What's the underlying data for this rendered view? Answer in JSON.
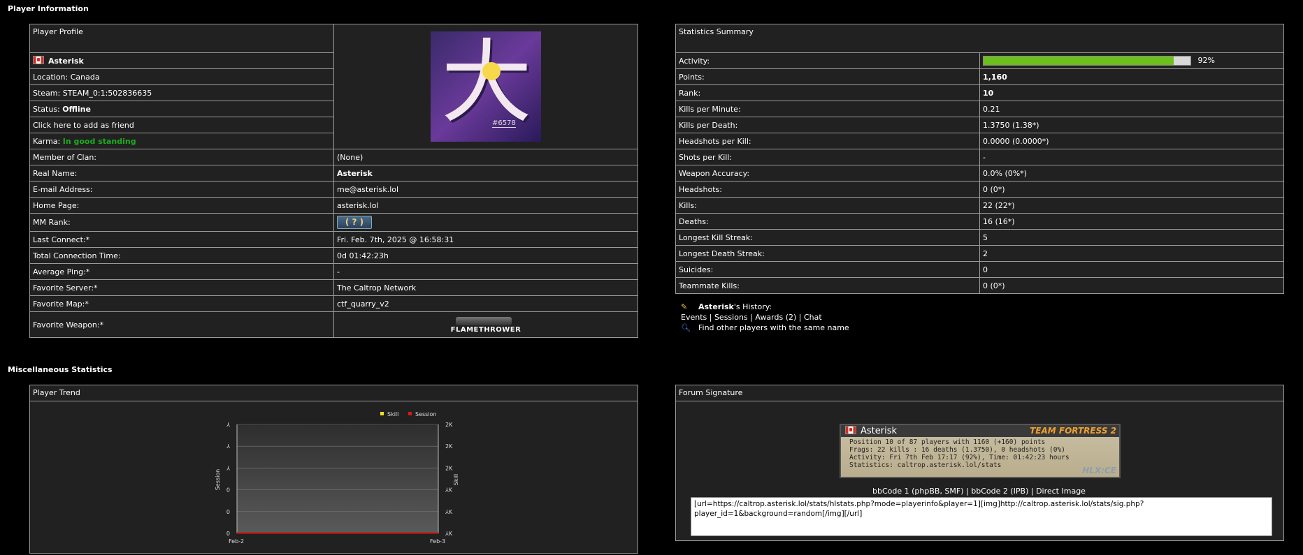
{
  "sections": {
    "player_info": "Player Information",
    "misc": "Miscellaneous Statistics"
  },
  "profile": {
    "header": "Player Profile",
    "name": "Asterisk",
    "location": "Location: Canada",
    "steam": "Steam: STEAM_0:1:502836635",
    "status_label": "Status: ",
    "status_value": "Offline",
    "add_friend": "Click here to add as friend",
    "karma_label": "Karma: ",
    "karma_value": "In good standing",
    "avatar_tag": "#6578",
    "rows": [
      {
        "label": "Member of Clan:",
        "value": "(None)"
      },
      {
        "label": "Real Name:",
        "value": "Asterisk"
      },
      {
        "label": "E-mail Address:",
        "value": "me@asterisk.lol"
      },
      {
        "label": "Home Page:",
        "value": "asterisk.lol"
      },
      {
        "label": "MM Rank:",
        "value": "( ? )"
      },
      {
        "label": "Last Connect:*",
        "value": "Fri. Feb. 7th, 2025 @ 16:58:31"
      },
      {
        "label": "Total Connection Time:",
        "value": "0d 01:42:23h"
      },
      {
        "label": "Average Ping:*",
        "value": "-"
      },
      {
        "label": "Favorite Server:*",
        "value": "The Caltrop Network"
      },
      {
        "label": "Favorite Map:*",
        "value": "ctf_quarry_v2"
      },
      {
        "label": "Favorite Weapon:*",
        "value": "FLAMETHROWER"
      }
    ]
  },
  "stats": {
    "header": "Statistics Summary",
    "activity_label": "Activity:",
    "activity_percent": 92,
    "activity_text": "92%",
    "rows": [
      {
        "label": "Points:",
        "value": "1,160"
      },
      {
        "label": "Rank:",
        "value": "10"
      },
      {
        "label": "Kills per Minute:",
        "value": "0.21"
      },
      {
        "label": "Kills per Death:",
        "value": "1.3750 (1.38*)"
      },
      {
        "label": "Headshots per Kill:",
        "value": "0.0000 (0.0000*)"
      },
      {
        "label": "Shots per Kill:",
        "value": "-"
      },
      {
        "label": "Weapon Accuracy:",
        "value": "0.0% (0%*)"
      },
      {
        "label": "Headshots:",
        "value": "0 (0*)"
      },
      {
        "label": "Kills:",
        "value": "22 (22*)"
      },
      {
        "label": "Deaths:",
        "value": "16 (16*)"
      },
      {
        "label": "Longest Kill Streak:",
        "value": "5"
      },
      {
        "label": "Longest Death Streak:",
        "value": "2"
      },
      {
        "label": "Suicides:",
        "value": "0"
      },
      {
        "label": "Teammate Kills:",
        "value": "0 (0*)"
      }
    ]
  },
  "history": {
    "name": "Asterisk",
    "suffix": "'s History:",
    "links": [
      "Events",
      "Sessions",
      "Awards (2)",
      "Chat"
    ],
    "separator": " | ",
    "find_other": "Find other players with the same name"
  },
  "trend": {
    "header": "Player Trend",
    "legend_skill": "Skill",
    "legend_session": "Session",
    "left_axis_label": "Session",
    "right_axis_label": "Skill",
    "left_ticks": [
      "⅄",
      "⅄",
      "⅄",
      "0",
      "0",
      "0"
    ],
    "right_ticks": [
      "2K",
      "2K",
      "2K",
      "⅄K",
      "⅄K",
      "⅄K"
    ],
    "x_start": "Feb-2",
    "x_end": "Feb-3",
    "colors": {
      "skill": "#f0e020",
      "session": "#d81818"
    }
  },
  "chart_data": {
    "type": "area",
    "title": "",
    "x": [
      "Feb-2",
      "Feb-3"
    ],
    "series": [
      {
        "name": "Skill",
        "values": [
          0,
          0
        ]
      },
      {
        "name": "Session",
        "values": [
          0,
          0
        ]
      }
    ],
    "xlabel": "",
    "ylabel": "Session",
    "y2label": "Skill",
    "grid": true,
    "legend": "top-right"
  },
  "signature": {
    "header": "Forum Signature",
    "name": "Asterisk",
    "game_logo": "TEAM FORTRESS 2",
    "hlx": "HLX:CE",
    "line1": "Position 10 of 87 players with 1160 (+160) points",
    "line2": "Frags: 22 kills : 16 deaths (1.3750), 0 headshots (0%)",
    "line3": "Activity: Fri 7th Feb 17:17 (92%), Time: 01:42:23 hours",
    "line4": "Statistics: caltrop.asterisk.lol/stats",
    "links": [
      "bbCode 1 (phpBB, SMF)",
      "bbCode 2 (IPB)",
      "Direct Image"
    ],
    "code": "[url=https://caltrop.asterisk.lol/stats/hlstats.php?mode=playerinfo&player=1][img]http://caltrop.asterisk.lol/stats/sig.php?player_id=1&background=random[/img][/url]"
  }
}
